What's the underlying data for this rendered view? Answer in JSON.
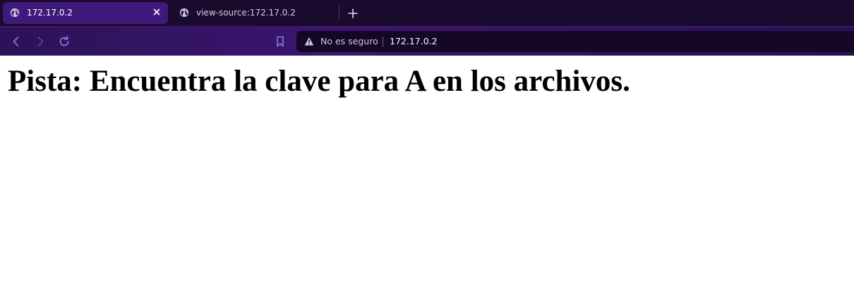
{
  "browser": {
    "tabs": [
      {
        "title": "172.17.0.2",
        "active": true,
        "icon": "globe-icon"
      },
      {
        "title": "view-source:172.17.0.2",
        "active": false,
        "icon": "globe-icon"
      }
    ],
    "new_tab_icon": "plus-icon",
    "nav": {
      "back_icon": "chevron-left-icon",
      "forward_icon": "chevron-right-icon",
      "reload_icon": "reload-icon",
      "bookmark_icon": "bookmark-icon"
    },
    "address_bar": {
      "security_icon": "warning-icon",
      "security_text": "No es seguro",
      "url": "172.17.0.2"
    },
    "colors": {
      "accent": "#3f1a7a",
      "tabbar_bg": "#1a0a2e",
      "urlbar_bg": "#150726"
    }
  },
  "page": {
    "heading": "Pista: Encuentra la clave para A en los archivos."
  }
}
